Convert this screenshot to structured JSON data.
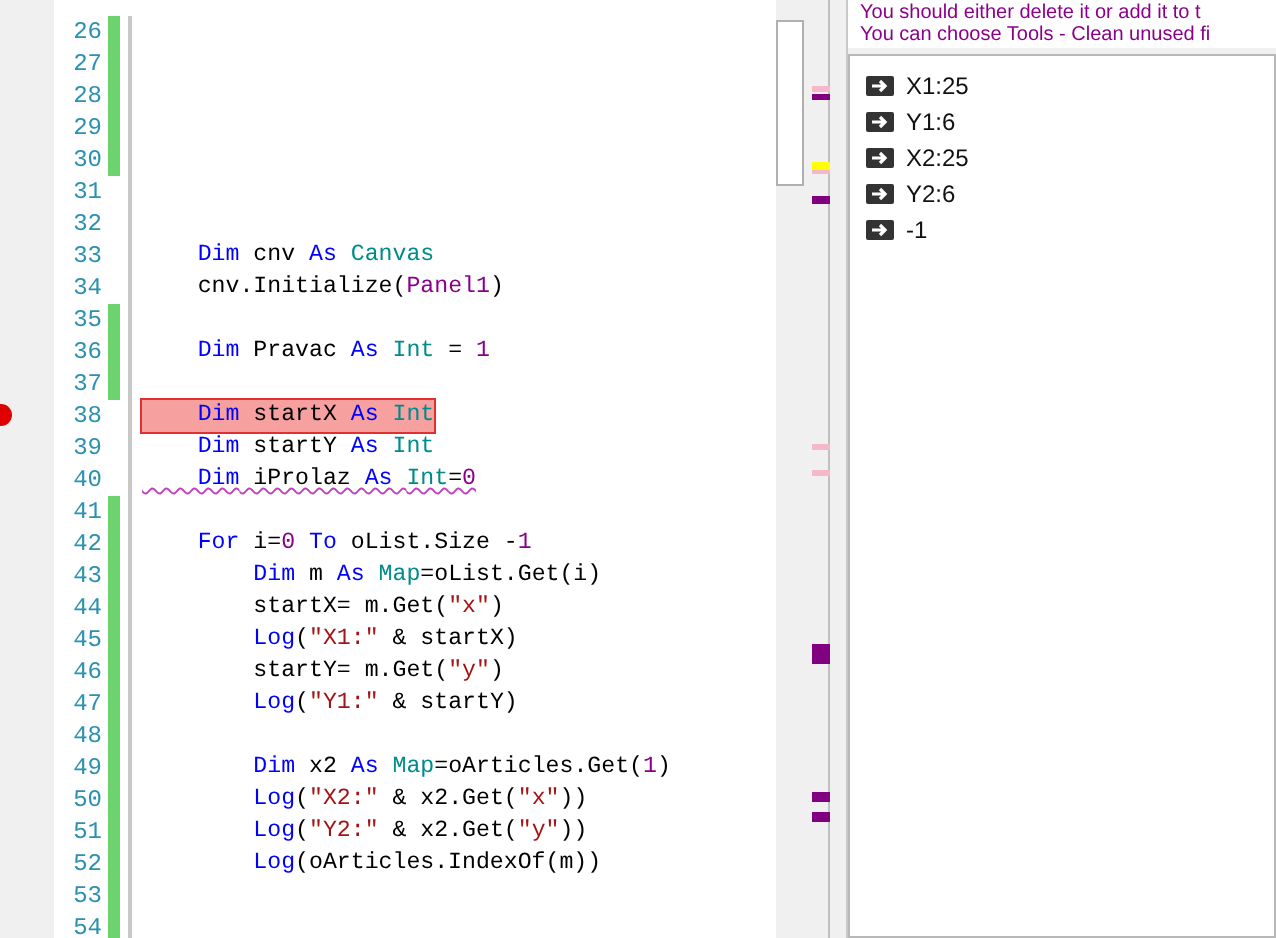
{
  "editor": {
    "lines": [
      {
        "number": "26",
        "changed": true
      },
      {
        "number": "27",
        "changed": true
      },
      {
        "number": "28",
        "changed": true
      },
      {
        "number": "29",
        "changed": true
      },
      {
        "number": "30",
        "changed": true
      },
      {
        "number": "31",
        "changed": false
      },
      {
        "number": "32",
        "changed": false
      },
      {
        "number": "33",
        "changed": false,
        "tokens": [
          {
            "kind": "keyword",
            "text": "    Dim"
          },
          {
            "kind": "plain",
            "text": " cnv "
          },
          {
            "kind": "keyword",
            "text": "As "
          },
          {
            "kind": "type",
            "text": "Canvas"
          }
        ]
      },
      {
        "number": "34",
        "changed": false,
        "tokens": [
          {
            "kind": "plain",
            "text": "    cnv.Initialize("
          },
          {
            "kind": "object",
            "text": "Panel1"
          },
          {
            "kind": "plain",
            "text": ")"
          }
        ]
      },
      {
        "number": "35",
        "changed": true
      },
      {
        "number": "36",
        "changed": true,
        "tokens": [
          {
            "kind": "keyword",
            "text": "    Dim"
          },
          {
            "kind": "plain",
            "text": " Pravac "
          },
          {
            "kind": "keyword",
            "text": "As "
          },
          {
            "kind": "type",
            "text": "Int"
          },
          {
            "kind": "plain",
            "text": " = "
          },
          {
            "kind": "number",
            "text": "1"
          }
        ]
      },
      {
        "number": "37",
        "changed": true
      },
      {
        "number": "38",
        "changed": false,
        "breakpoint": true,
        "tokens": [
          {
            "kind": "keyword",
            "text": "    Dim"
          },
          {
            "kind": "plain",
            "text": " startX "
          },
          {
            "kind": "keyword",
            "text": "As "
          },
          {
            "kind": "type",
            "text": "Int"
          }
        ]
      },
      {
        "number": "39",
        "changed": false,
        "tokens": [
          {
            "kind": "keyword",
            "text": "    Dim"
          },
          {
            "kind": "plain",
            "text": " startY "
          },
          {
            "kind": "keyword",
            "text": "As "
          },
          {
            "kind": "type",
            "text": "Int"
          }
        ]
      },
      {
        "number": "40",
        "changed": false,
        "warning": true,
        "tokens": [
          {
            "kind": "keyword",
            "text": "    Dim"
          },
          {
            "kind": "plain",
            "text": " iProlaz "
          },
          {
            "kind": "keyword",
            "text": "As "
          },
          {
            "kind": "type",
            "text": "Int"
          },
          {
            "kind": "plain",
            "text": "="
          },
          {
            "kind": "number",
            "text": "0"
          }
        ]
      },
      {
        "number": "41",
        "changed": true
      },
      {
        "number": "42",
        "changed": true,
        "tokens": [
          {
            "kind": "keyword",
            "text": "    For"
          },
          {
            "kind": "plain",
            "text": " i="
          },
          {
            "kind": "number",
            "text": "0"
          },
          {
            "kind": "keyword",
            "text": " To"
          },
          {
            "kind": "plain",
            "text": " oList.Size -"
          },
          {
            "kind": "number",
            "text": "1"
          }
        ]
      },
      {
        "number": "43",
        "changed": true,
        "tokens": [
          {
            "kind": "keyword",
            "text": "        Dim"
          },
          {
            "kind": "plain",
            "text": " m "
          },
          {
            "kind": "keyword",
            "text": "As "
          },
          {
            "kind": "type",
            "text": "Map"
          },
          {
            "kind": "plain",
            "text": "=oList.Get(i)"
          }
        ]
      },
      {
        "number": "44",
        "changed": true,
        "tokens": [
          {
            "kind": "plain",
            "text": "        startX= m.Get("
          },
          {
            "kind": "string",
            "text": "\"x\""
          },
          {
            "kind": "plain",
            "text": ")"
          }
        ]
      },
      {
        "number": "45",
        "changed": true,
        "tokens": [
          {
            "kind": "keyword",
            "text": "        Log"
          },
          {
            "kind": "plain",
            "text": "("
          },
          {
            "kind": "string",
            "text": "\"X1:\""
          },
          {
            "kind": "plain",
            "text": " & startX)"
          }
        ]
      },
      {
        "number": "46",
        "changed": true,
        "tokens": [
          {
            "kind": "plain",
            "text": "        startY= m.Get("
          },
          {
            "kind": "string",
            "text": "\"y\""
          },
          {
            "kind": "plain",
            "text": ")"
          }
        ]
      },
      {
        "number": "47",
        "changed": true,
        "tokens": [
          {
            "kind": "keyword",
            "text": "        Log"
          },
          {
            "kind": "plain",
            "text": "("
          },
          {
            "kind": "string",
            "text": "\"Y1:\""
          },
          {
            "kind": "plain",
            "text": " & startY)"
          }
        ]
      },
      {
        "number": "48",
        "changed": true
      },
      {
        "number": "49",
        "changed": true,
        "tokens": [
          {
            "kind": "keyword",
            "text": "        Dim"
          },
          {
            "kind": "plain",
            "text": " x2 "
          },
          {
            "kind": "keyword",
            "text": "As "
          },
          {
            "kind": "type",
            "text": "Map"
          },
          {
            "kind": "plain",
            "text": "=oArticles.Get("
          },
          {
            "kind": "number",
            "text": "1"
          },
          {
            "kind": "plain",
            "text": ")"
          }
        ]
      },
      {
        "number": "50",
        "changed": true,
        "tokens": [
          {
            "kind": "keyword",
            "text": "        Log"
          },
          {
            "kind": "plain",
            "text": "("
          },
          {
            "kind": "string",
            "text": "\"X2:\""
          },
          {
            "kind": "plain",
            "text": " & x2.Get("
          },
          {
            "kind": "string",
            "text": "\"x\""
          },
          {
            "kind": "plain",
            "text": "))"
          }
        ]
      },
      {
        "number": "51",
        "changed": true,
        "tokens": [
          {
            "kind": "keyword",
            "text": "        Log"
          },
          {
            "kind": "plain",
            "text": "("
          },
          {
            "kind": "string",
            "text": "\"Y2:\""
          },
          {
            "kind": "plain",
            "text": " & x2.Get("
          },
          {
            "kind": "string",
            "text": "\"y\""
          },
          {
            "kind": "plain",
            "text": "))"
          }
        ]
      },
      {
        "number": "52",
        "changed": true,
        "tokens": [
          {
            "kind": "keyword",
            "text": "        Log"
          },
          {
            "kind": "plain",
            "text": "(oArticles.IndexOf(m))"
          }
        ]
      },
      {
        "number": "53",
        "changed": true
      },
      {
        "number": "54",
        "changed": true
      }
    ]
  },
  "warnings": [
    "You should either delete it or add it to t",
    "You can choose Tools - Clean unused fi"
  ],
  "logs": [
    {
      "text": "X1:25"
    },
    {
      "text": "Y1:6"
    },
    {
      "text": "X2:25"
    },
    {
      "text": "Y2:6"
    },
    {
      "text": "-1"
    }
  ]
}
